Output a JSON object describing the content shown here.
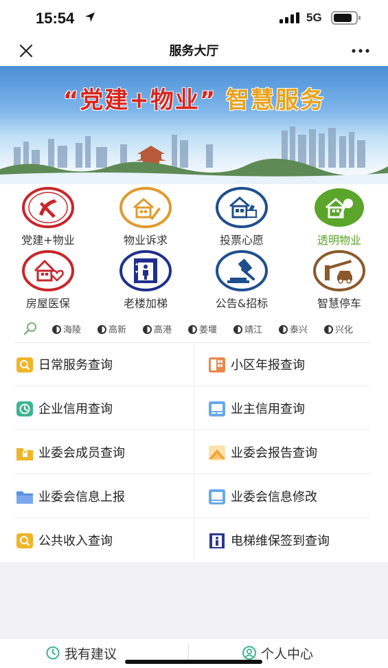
{
  "status_bar": {
    "time": "15:54",
    "network": "5G"
  },
  "nav": {
    "title": "服务大厅"
  },
  "banner": {
    "title_part1": "“党建+物业”",
    "title_part2": "智慧服务"
  },
  "grid": [
    {
      "label": "党建+物业",
      "icon": "party-emblem-icon",
      "color": "#c8262c"
    },
    {
      "label": "物业诉求",
      "icon": "house-pen-icon",
      "color": "#e09a2d"
    },
    {
      "label": "投票心愿",
      "icon": "ballot-house-icon",
      "color": "#1f4e8c"
    },
    {
      "label": "透明物业",
      "icon": "house-magnifier-icon",
      "color": "#5aa52a"
    },
    {
      "label": "房屋医保",
      "icon": "house-heart-icon",
      "color": "#c8262c"
    },
    {
      "label": "老楼加梯",
      "icon": "elevator-icon",
      "color": "#1f2f8c"
    },
    {
      "label": "公告&招标",
      "icon": "gavel-icon",
      "color": "#1f4e8c"
    },
    {
      "label": "智慧停车",
      "icon": "parking-barrier-icon",
      "color": "#8a5a2b"
    }
  ],
  "districts": [
    "海陵",
    "高新",
    "高港",
    "姜堰",
    "靖江",
    "泰兴",
    "兴化"
  ],
  "queries": [
    {
      "label": "日常服务查询",
      "icon": "search-doc-icon",
      "color": "#f0b429"
    },
    {
      "label": "小区年报查询",
      "icon": "report-icon",
      "color": "#e8884a"
    },
    {
      "label": "企业信用查询",
      "icon": "clock-icon",
      "color": "#3cb58f"
    },
    {
      "label": "业主信用查询",
      "icon": "card-icon",
      "color": "#6aa8e8"
    },
    {
      "label": "业委会成员查询",
      "icon": "folder-lock-icon",
      "color": "#f0b429"
    },
    {
      "label": "业委会报告查询",
      "icon": "mountain-icon",
      "color": "#f0a030"
    },
    {
      "label": "业委会信息上报",
      "icon": "folder-icon",
      "color": "#5a8fe0"
    },
    {
      "label": "业委会信息修改",
      "icon": "doc-edit-icon",
      "color": "#6aa8e8"
    },
    {
      "label": "公共收入查询",
      "icon": "search-doc-icon",
      "color": "#f0b429"
    },
    {
      "label": "电梯维保签到查询",
      "icon": "elevator-small-icon",
      "color": "#2b3a8c"
    }
  ],
  "bottom": {
    "suggest": "我有建议",
    "personal": "个人中心"
  }
}
